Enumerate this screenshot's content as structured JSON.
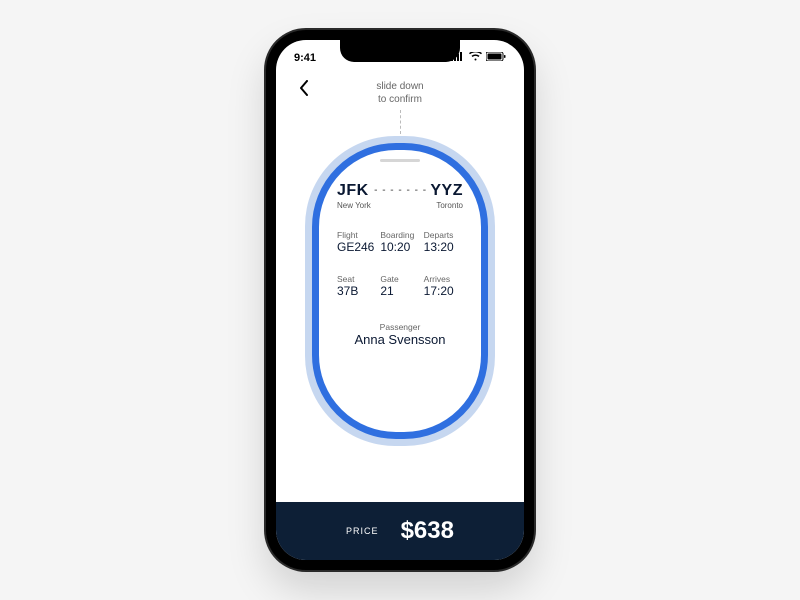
{
  "status": {
    "time": "9:41"
  },
  "header": {
    "hint_line1": "slide down",
    "hint_line2": "to confirm"
  },
  "route": {
    "from_code": "JFK",
    "from_city": "New York",
    "to_code": "YYZ",
    "to_city": "Toronto",
    "dots": "- - - - - - -"
  },
  "details": {
    "flight_label": "Flight",
    "flight": "GE246",
    "boarding_label": "Boarding",
    "boarding": "10:20",
    "departs_label": "Departs",
    "departs": "13:20",
    "seat_label": "Seat",
    "seat": "37B",
    "gate_label": "Gate",
    "gate": "21",
    "arrives_label": "Arrives",
    "arrives": "17:20"
  },
  "passenger": {
    "label": "Passenger",
    "name": "Anna Svensson"
  },
  "price": {
    "label": "PRICE",
    "value": "$638"
  }
}
